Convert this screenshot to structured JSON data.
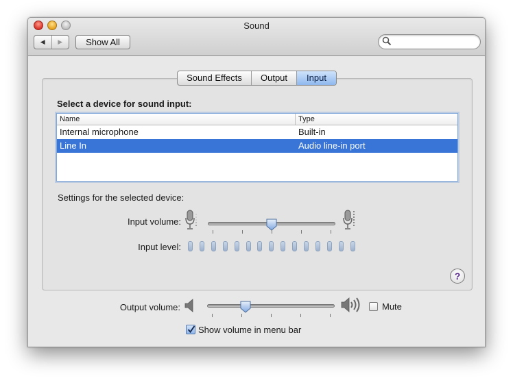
{
  "window": {
    "title": "Sound",
    "show_all_label": "Show All",
    "search_placeholder": "",
    "nav_back_glyph": "◀",
    "nav_forward_glyph": "▶"
  },
  "tabs": [
    {
      "label": "Sound Effects",
      "selected": false
    },
    {
      "label": "Output",
      "selected": false
    },
    {
      "label": "Input",
      "selected": true
    }
  ],
  "input": {
    "heading": "Select a device for sound input:",
    "columns": {
      "name": "Name",
      "type": "Type"
    },
    "devices": [
      {
        "name": "Internal microphone",
        "type": "Built-in",
        "selected": false
      },
      {
        "name": "Line In",
        "type": "Audio line-in port",
        "selected": true
      }
    ],
    "settings_label": "Settings for the selected device:",
    "volume_label": "Input volume:",
    "volume_value": 0.5,
    "level_label": "Input level:",
    "level_value": 0,
    "level_segments": 15
  },
  "help_glyph": "?",
  "output": {
    "volume_label": "Output volume:",
    "volume_value": 0.3,
    "mute_label": "Mute",
    "mute_checked": false,
    "menu_bar_label": "Show volume in menu bar",
    "menu_bar_checked": true
  },
  "colors": {
    "selection": "#3875d7",
    "selected_tab": "#8fb8ee",
    "help_glyph": "#5a2b8a"
  },
  "icons": [
    "search-icon",
    "microphone-low-icon",
    "microphone-high-icon",
    "speaker-low-icon",
    "speaker-high-icon",
    "help-icon",
    "checkmark-icon"
  ]
}
